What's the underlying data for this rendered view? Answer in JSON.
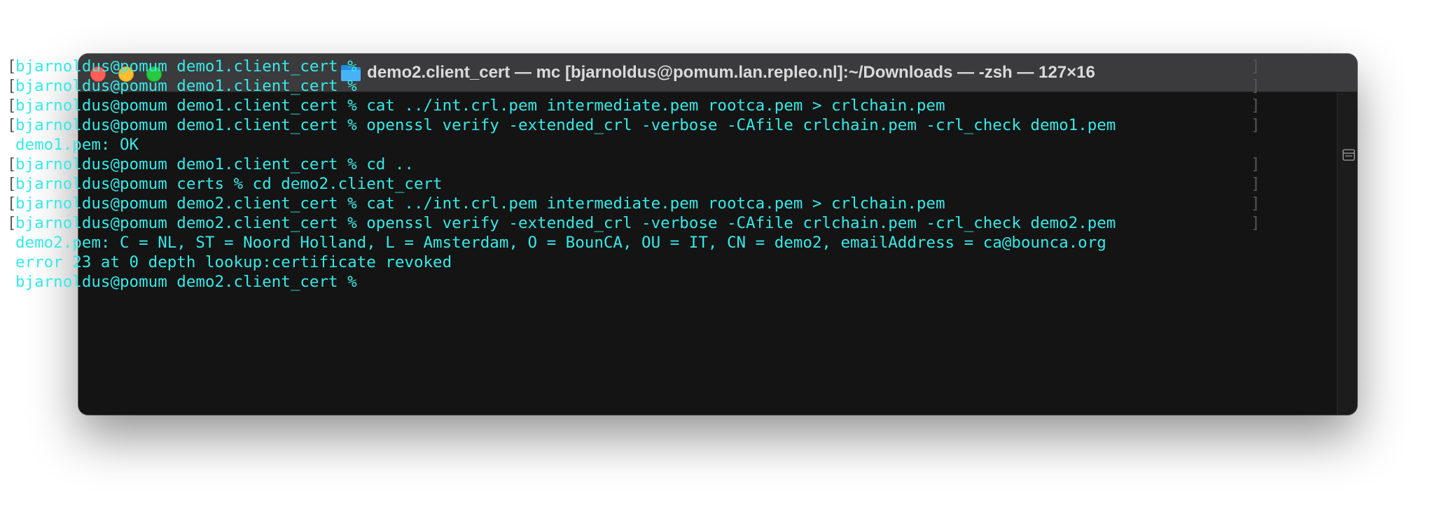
{
  "window": {
    "title": "demo2.client_cert — mc [bjarnoldus@pomum.lan.repleo.nl]:~/Downloads — -zsh — 127×16",
    "title_icon": "folder-icon",
    "buttons": [
      "close",
      "minimize",
      "maximize"
    ]
  },
  "colors": {
    "text": "#36eae8",
    "background": "#141414",
    "titlebar": "#3b3b3d",
    "close": "#ff5f57",
    "minimize": "#febc2e",
    "maximize": "#28c840"
  },
  "terminal": {
    "lines": [
      {
        "text": "bjarnoldus@pomum demo1.client_cert %",
        "marked": true
      },
      {
        "text": "bjarnoldus@pomum demo1.client_cert %",
        "marked": true
      },
      {
        "text": "bjarnoldus@pomum demo1.client_cert % cat ../int.crl.pem intermediate.pem rootca.pem > crlchain.pem",
        "marked": true
      },
      {
        "text": "bjarnoldus@pomum demo1.client_cert % openssl verify -extended_crl -verbose -CAfile crlchain.pem -crl_check demo1.pem",
        "marked": true
      },
      {
        "text": "demo1.pem: OK",
        "marked": false
      },
      {
        "text": "bjarnoldus@pomum demo1.client_cert % cd ..",
        "marked": true
      },
      {
        "text": "bjarnoldus@pomum certs % cd demo2.client_cert",
        "marked": true
      },
      {
        "text": "bjarnoldus@pomum demo2.client_cert % cat ../int.crl.pem intermediate.pem rootca.pem > crlchain.pem",
        "marked": true
      },
      {
        "text": "bjarnoldus@pomum demo2.client_cert % openssl verify -extended_crl -verbose -CAfile crlchain.pem -crl_check demo2.pem",
        "marked": true
      },
      {
        "text": "demo2.pem: C = NL, ST = Noord Holland, L = Amsterdam, O = BounCA, OU = IT, CN = demo2, emailAddress = ca@bounca.org",
        "marked": false
      },
      {
        "text": "error 23 at 0 depth lookup:certificate revoked",
        "marked": false
      },
      {
        "text": "bjarnoldus@pomum demo2.client_cert %",
        "marked": false
      }
    ]
  }
}
